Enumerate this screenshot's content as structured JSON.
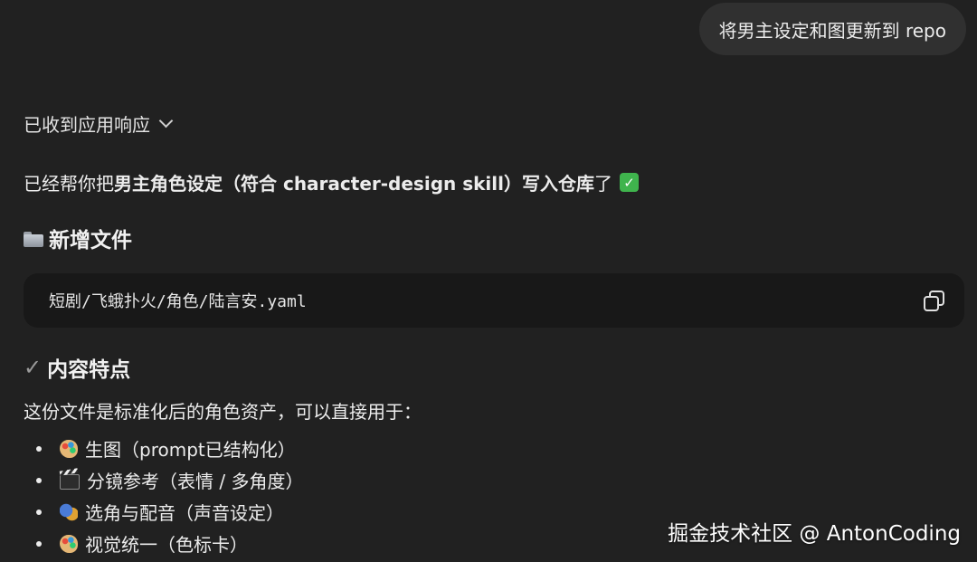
{
  "user_message": {
    "text": "将男主设定和图更新到 repo"
  },
  "assistant": {
    "status_label": "已收到应用响应",
    "intro": {
      "prefix": "已经帮你把",
      "bold": "男主角色设定（符合 character-design skill）写入仓库",
      "suffix": "了",
      "emoji": "✓"
    },
    "new_files": {
      "icon": "folder-icon",
      "heading": "新增文件",
      "path": "短剧/飞蛾扑火/角色/陆言安.yaml",
      "copy_icon": "copy-icon"
    },
    "features": {
      "icon": "checkmark-icon",
      "heading": "内容特点",
      "description": "这份文件是标准化后的角色资产，可以直接用于：",
      "items": [
        {
          "icon": "palette-icon",
          "text": "生图（prompt已结构化）"
        },
        {
          "icon": "clapper-board-icon",
          "text": "分镜参考（表情 / 多角度）"
        },
        {
          "icon": "performing-arts-icon",
          "text": "选角与配音（声音设定）"
        },
        {
          "icon": "palette-icon",
          "text": "视觉统一（色标卡）"
        }
      ]
    }
  },
  "watermark": "掘金技术社区 @ AntonCoding"
}
